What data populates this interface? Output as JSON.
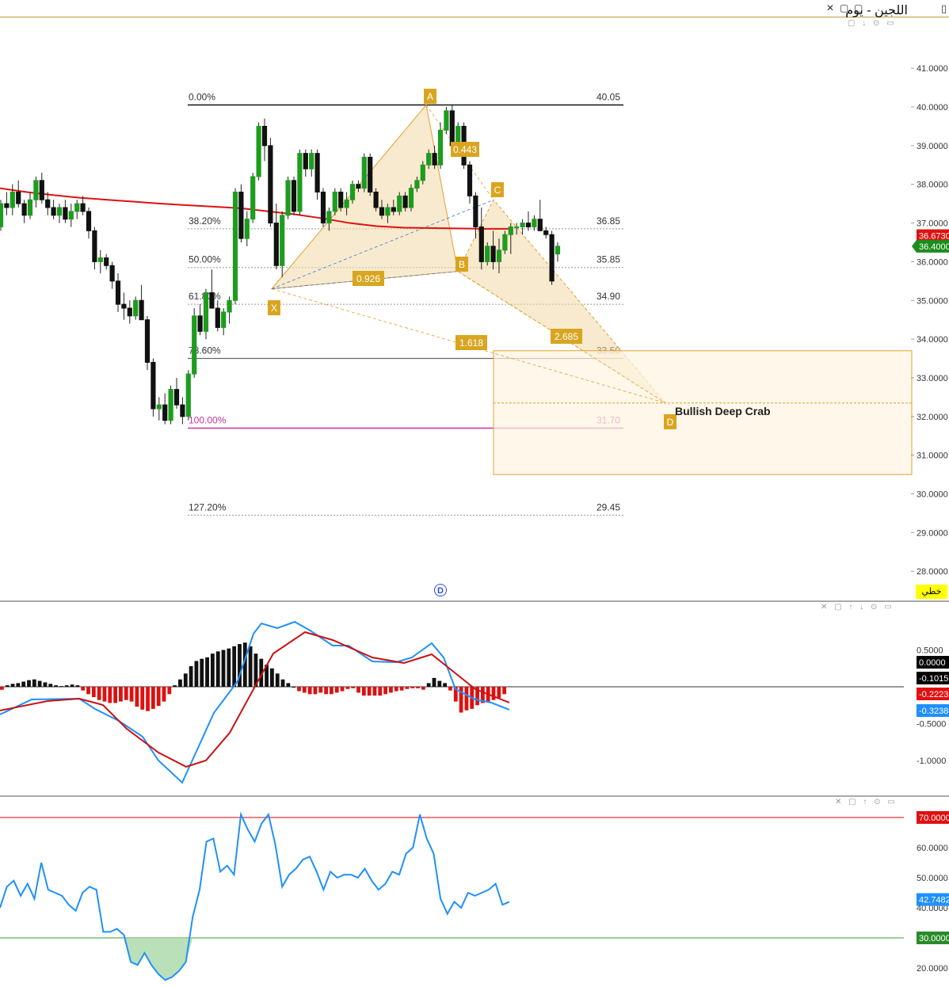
{
  "window": {
    "title": "اللجين - يوم",
    "close_icon": "close-icon",
    "restore_icon": "restore-icon",
    "minimize_icon": "minimize-icon",
    "mode_label": "خطي",
    "pane_controls": "▢ ↓ ⊙ ▭",
    "pane2_controls": "✕ ▢ ↑ ↓ ⊙ ▭",
    "pane3_controls": "✕ ▢ ↑ ⊙ ▭",
    "d_marker": "D"
  },
  "colors": {
    "up": "#1e9c1e",
    "down": "#111111",
    "ma": "#dd1111",
    "pattern_fill": "#f3d9a6",
    "label_bg": "#d9a520",
    "macd_line": "#1e90ff",
    "signal_line": "#cc1111",
    "hist_pos": "#111111",
    "hist_neg": "#dd1111",
    "rsi_line": "#1e90ff",
    "rsi_fill": "#a8d8a8",
    "fib_100": "#cc3399"
  },
  "chart_data": [
    {
      "type": "candlestick",
      "title": "اللجين - يوم",
      "ylim": [
        27.5,
        41.3
      ],
      "y_ticks": [
        "41.0000",
        "40.0000",
        "39.0000",
        "38.0000",
        "37.0000",
        "36.0000",
        "35.0000",
        "34.0000",
        "33.0000",
        "32.0000",
        "31.0000",
        "30.0000",
        "29.0000",
        "28.0000"
      ],
      "last_price": "36.4000",
      "ma_value": "36.6730",
      "candles": [
        [
          36.9,
          37.6,
          36.8,
          37.5
        ],
        [
          37.5,
          37.8,
          37.2,
          37.4
        ],
        [
          37.4,
          38.0,
          37.2,
          37.8
        ],
        [
          37.8,
          38.1,
          37.4,
          37.5
        ],
        [
          37.5,
          37.6,
          37.0,
          37.2
        ],
        [
          37.2,
          37.8,
          37.1,
          37.6
        ],
        [
          37.6,
          38.2,
          37.4,
          38.1
        ],
        [
          38.1,
          38.3,
          37.5,
          37.6
        ],
        [
          37.6,
          37.8,
          37.2,
          37.4
        ],
        [
          37.4,
          37.6,
          37.1,
          37.2
        ],
        [
          37.2,
          37.5,
          37.0,
          37.4
        ],
        [
          37.4,
          37.6,
          37.0,
          37.1
        ],
        [
          37.1,
          37.5,
          36.9,
          37.3
        ],
        [
          37.3,
          37.6,
          37.1,
          37.5
        ],
        [
          37.5,
          37.7,
          37.2,
          37.3
        ],
        [
          37.3,
          37.4,
          36.6,
          36.8
        ],
        [
          36.8,
          36.9,
          35.8,
          36.0
        ],
        [
          36.0,
          36.3,
          35.7,
          36.1
        ],
        [
          36.1,
          36.2,
          35.8,
          35.9
        ],
        [
          35.9,
          36.0,
          35.3,
          35.5
        ],
        [
          35.5,
          35.7,
          34.7,
          34.9
        ],
        [
          34.9,
          35.2,
          34.5,
          34.8
        ],
        [
          34.8,
          35.0,
          34.4,
          34.6
        ],
        [
          34.6,
          35.1,
          34.5,
          35.0
        ],
        [
          35.0,
          35.4,
          34.6,
          34.5
        ],
        [
          34.5,
          34.6,
          33.2,
          33.4
        ],
        [
          33.4,
          33.5,
          32.0,
          32.2
        ],
        [
          32.2,
          32.5,
          31.9,
          32.3
        ],
        [
          32.3,
          32.6,
          31.8,
          31.9
        ],
        [
          31.9,
          32.8,
          31.8,
          32.7
        ],
        [
          32.7,
          33.0,
          32.2,
          32.3
        ],
        [
          32.3,
          32.5,
          31.8,
          32.0
        ],
        [
          32.0,
          33.2,
          31.9,
          33.1
        ],
        [
          33.1,
          34.8,
          33.0,
          34.6
        ],
        [
          34.6,
          34.9,
          34.1,
          34.2
        ],
        [
          34.2,
          35.3,
          34.0,
          35.2
        ],
        [
          35.2,
          35.8,
          34.8,
          34.8
        ],
        [
          34.8,
          35.0,
          34.2,
          34.3
        ],
        [
          34.3,
          34.8,
          34.1,
          34.7
        ],
        [
          34.7,
          35.1,
          34.4,
          35.0
        ],
        [
          35.0,
          37.9,
          34.9,
          37.8
        ],
        [
          37.8,
          38.0,
          36.5,
          36.6
        ],
        [
          36.6,
          37.3,
          36.4,
          37.1
        ],
        [
          37.1,
          38.3,
          37.0,
          38.2
        ],
        [
          38.2,
          39.6,
          38.1,
          39.5
        ],
        [
          39.5,
          39.7,
          38.6,
          39.0
        ],
        [
          39.0,
          39.2,
          36.9,
          37.0
        ],
        [
          37.0,
          37.5,
          35.8,
          35.9
        ],
        [
          35.9,
          37.3,
          35.6,
          37.2
        ],
        [
          37.2,
          38.2,
          37.1,
          38.1
        ],
        [
          38.1,
          38.2,
          37.2,
          37.3
        ],
        [
          37.3,
          38.9,
          37.2,
          38.8
        ],
        [
          38.8,
          38.9,
          38.2,
          38.4
        ],
        [
          38.4,
          38.9,
          38.2,
          38.8
        ],
        [
          38.8,
          38.9,
          37.6,
          37.8
        ],
        [
          37.8,
          37.9,
          36.9,
          37.0
        ],
        [
          37.0,
          37.4,
          36.8,
          37.3
        ],
        [
          37.3,
          37.9,
          37.2,
          37.8
        ],
        [
          37.8,
          37.9,
          37.3,
          37.4
        ],
        [
          37.4,
          37.8,
          37.2,
          37.6
        ],
        [
          37.6,
          38.1,
          37.5,
          38.0
        ],
        [
          38.0,
          38.1,
          37.8,
          37.9
        ],
        [
          37.9,
          38.8,
          37.8,
          38.7
        ],
        [
          38.7,
          38.8,
          37.7,
          37.8
        ],
        [
          37.8,
          37.9,
          37.3,
          37.4
        ],
        [
          37.4,
          37.6,
          37.1,
          37.2
        ],
        [
          37.2,
          37.5,
          37.0,
          37.4
        ],
        [
          37.4,
          37.6,
          37.2,
          37.3
        ],
        [
          37.3,
          37.8,
          37.2,
          37.7
        ],
        [
          37.7,
          37.8,
          37.3,
          37.4
        ],
        [
          37.4,
          38.0,
          37.3,
          37.9
        ],
        [
          37.9,
          38.2,
          37.8,
          38.1
        ],
        [
          38.1,
          38.6,
          38.0,
          38.5
        ],
        [
          38.5,
          38.9,
          38.4,
          38.8
        ],
        [
          38.8,
          39.0,
          38.4,
          38.5
        ],
        [
          38.5,
          39.6,
          38.4,
          39.4
        ],
        [
          39.4,
          40.0,
          39.3,
          39.9
        ],
        [
          39.9,
          40.05,
          38.9,
          39.0
        ],
        [
          39.0,
          39.6,
          38.8,
          39.5
        ],
        [
          39.5,
          39.6,
          38.4,
          38.5
        ],
        [
          38.5,
          38.6,
          37.5,
          37.7
        ],
        [
          37.7,
          37.8,
          36.6,
          36.9
        ],
        [
          36.9,
          37.4,
          35.8,
          36.0
        ],
        [
          36.0,
          36.5,
          35.9,
          36.4
        ],
        [
          36.4,
          36.8,
          35.8,
          36.0
        ],
        [
          36.0,
          36.6,
          35.7,
          36.3
        ],
        [
          36.3,
          36.8,
          36.2,
          36.7
        ],
        [
          36.7,
          37.0,
          36.2,
          36.9
        ],
        [
          36.9,
          37.0,
          36.7,
          36.9
        ],
        [
          36.9,
          37.1,
          36.7,
          37.0
        ],
        [
          37.0,
          37.3,
          36.8,
          36.9
        ],
        [
          36.9,
          37.2,
          36.8,
          37.1
        ],
        [
          37.1,
          37.6,
          36.9,
          36.8
        ],
        [
          36.8,
          36.9,
          36.6,
          36.7
        ],
        [
          36.7,
          36.8,
          35.4,
          35.5
        ],
        [
          36.2,
          36.5,
          36.0,
          36.4
        ]
      ],
      "moving_average": [
        37.9,
        37.8,
        37.72,
        37.65,
        37.6,
        37.55,
        37.5,
        37.46,
        37.42,
        37.38,
        37.3,
        37.22,
        37.12,
        37.0,
        36.92,
        36.88,
        36.87,
        36.86,
        36.85,
        36.85
      ],
      "fibonacci": {
        "levels": [
          {
            "pct": "0.00%",
            "value": 40.05,
            "label": "40.05"
          },
          {
            "pct": "38.20%",
            "value": 36.85,
            "label": "36.85"
          },
          {
            "pct": "50.00%",
            "value": 35.85,
            "label": "35.85"
          },
          {
            "pct": "61.80%",
            "value": 34.9,
            "label": "34.90"
          },
          {
            "pct": "78.60%",
            "value": 33.5,
            "label": "33.50"
          },
          {
            "pct": "100.00%",
            "value": 31.7,
            "label": "31.70"
          },
          {
            "pct": "127.20%",
            "value": 29.45,
            "label": "29.45"
          }
        ]
      },
      "harmonic": {
        "name": "Bullish Deep Crab",
        "points": {
          "X": 35.3,
          "A": 40.05,
          "B": 35.75,
          "C": 37.6,
          "D": 32.35
        },
        "ratios": {
          "XB": "0.926",
          "AC": "0.443",
          "BD": "2.685",
          "XD": "1.618"
        },
        "prz": [
          30.5,
          33.7
        ]
      }
    },
    {
      "type": "macd",
      "ylim": [
        -1.5,
        1.0
      ],
      "y_ticks": [
        "0.5000",
        "-0.5000",
        "-1.0000"
      ],
      "zero_label": "0.0000",
      "hist_label": "-0.1015",
      "signal_label": "-0.2223",
      "macd_label": "-0.3238"
    },
    {
      "type": "rsi",
      "ylim": [
        17,
        73
      ],
      "levels": {
        "upper": 70,
        "lower": 30
      },
      "y_ticks": [
        "60.0000",
        "50.0000",
        "40.0000",
        "20.0000"
      ],
      "upper_label": "70.0000",
      "lower_label": "30.0000",
      "current_label": "42.7482",
      "values": [
        40,
        47,
        49,
        44,
        48,
        43,
        55,
        46,
        45,
        44,
        41,
        39,
        45,
        47,
        46,
        32,
        32,
        33,
        31,
        22,
        21,
        25,
        21,
        18,
        16,
        17,
        19,
        22,
        37,
        46,
        62,
        63,
        52,
        54,
        51,
        71,
        66,
        62,
        68,
        71,
        61,
        47,
        51,
        53,
        56,
        57,
        52,
        46,
        52,
        50,
        51,
        51,
        50,
        53,
        49,
        46,
        48,
        52,
        51,
        58,
        60,
        71,
        63,
        58,
        43,
        38,
        42,
        40,
        45,
        44,
        45,
        46,
        48,
        41,
        42
      ]
    }
  ]
}
